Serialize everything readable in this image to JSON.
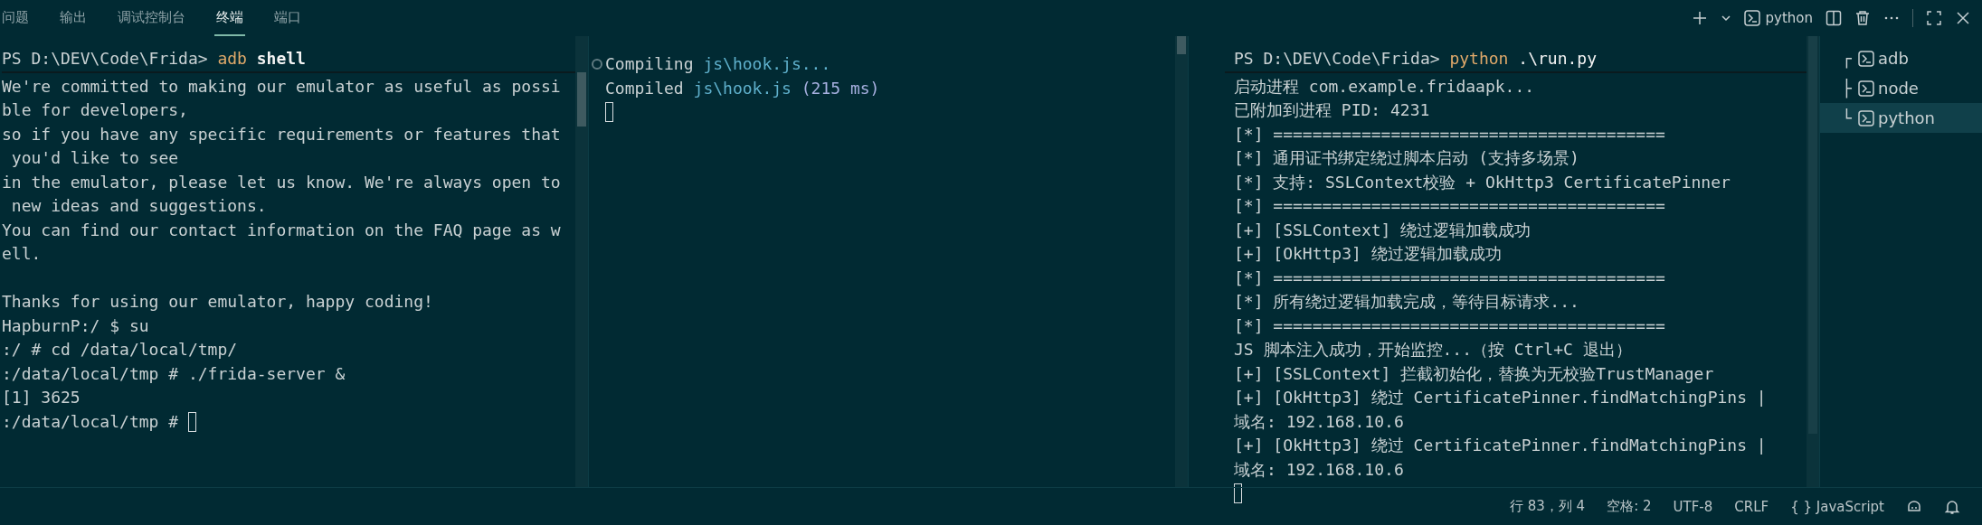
{
  "panel_tabs": [
    {
      "label": "问题",
      "selected": false
    },
    {
      "label": "输出",
      "selected": false
    },
    {
      "label": "调试控制台",
      "selected": false
    },
    {
      "label": "终端",
      "selected": true
    },
    {
      "label": "端口",
      "selected": false
    }
  ],
  "toolbar": {
    "terminal_name": "python"
  },
  "terminals": [
    {
      "lines": [
        {
          "kind": "prompt",
          "segments": [
            {
              "kind": "text",
              "text": "PS D:\\DEV\\Code\\Frida> "
            },
            {
              "kind": "command",
              "text": "adb"
            },
            {
              "kind": "argument",
              "text": " shell"
            }
          ]
        },
        {
          "kind": "output",
          "text": "We're committed to making our emulator as useful as possi"
        },
        {
          "kind": "output",
          "text": "ble for developers,"
        },
        {
          "kind": "output",
          "text": "so if you have any specific requirements or features that"
        },
        {
          "kind": "output",
          "text": " you'd like to see"
        },
        {
          "kind": "output",
          "text": "in the emulator, please let us know. We're always open to"
        },
        {
          "kind": "output",
          "text": " new ideas and suggestions."
        },
        {
          "kind": "output",
          "text": "You can find our contact information on the FAQ page as w"
        },
        {
          "kind": "output",
          "text": "ell."
        },
        {
          "kind": "blank"
        },
        {
          "kind": "output",
          "text": "Thanks for using our emulator, happy coding!"
        },
        {
          "kind": "output",
          "text": "HapburnP:/ $ su"
        },
        {
          "kind": "output",
          "text": ":/ # cd /data/local/tmp/"
        },
        {
          "kind": "output",
          "text": ":/data/local/tmp # ./frida-server &"
        },
        {
          "kind": "output",
          "text": "[1] 3625"
        },
        {
          "kind": "output",
          "text": ":/data/local/tmp # ",
          "cursor": true
        }
      ]
    },
    {
      "lines": [
        {
          "kind": "compile",
          "segments": [
            {
              "kind": "text",
              "text": "Compiling "
            },
            {
              "kind": "path",
              "text": "js\\hook.js..."
            }
          ]
        },
        {
          "kind": "output",
          "segments": [
            {
              "kind": "text",
              "text": "Compiled "
            },
            {
              "kind": "path",
              "text": "js\\hook.js"
            },
            {
              "kind": "number",
              "text": " (215 ms)"
            }
          ]
        },
        {
          "kind": "blank",
          "cursor": true
        }
      ]
    },
    {
      "lines": [
        {
          "kind": "prompt",
          "segments": [
            {
              "kind": "text",
              "text": "PS D:\\DEV\\Code\\Frida> "
            },
            {
              "kind": "command",
              "text": "python"
            },
            {
              "kind": "argument",
              "text": " .\\run.py"
            }
          ]
        },
        {
          "kind": "output",
          "text": "启动进程 com.example.fridaapk..."
        },
        {
          "kind": "output",
          "text": "已附加到进程 PID: 4231"
        },
        {
          "kind": "output",
          "text": "[*] ========================================"
        },
        {
          "kind": "output",
          "text": "[*] 通用证书绑定绕过脚本启动 (支持多场景)"
        },
        {
          "kind": "output",
          "text": "[*] 支持: SSLContext校验 + OkHttp3 CertificatePinner"
        },
        {
          "kind": "output",
          "text": "[*] ========================================"
        },
        {
          "kind": "output",
          "text": "[+] [SSLContext] 绕过逻辑加载成功"
        },
        {
          "kind": "output",
          "text": "[+] [OkHttp3] 绕过逻辑加载成功"
        },
        {
          "kind": "output",
          "text": "[*] ========================================"
        },
        {
          "kind": "output",
          "text": "[*] 所有绕过逻辑加载完成，等待目标请求..."
        },
        {
          "kind": "output",
          "text": "[*] ========================================"
        },
        {
          "kind": "output",
          "text": "JS 脚本注入成功，开始监控...（按 Ctrl+C 退出）"
        },
        {
          "kind": "output",
          "text": "[+] [SSLContext] 拦截初始化，替换为无校验TrustManager"
        },
        {
          "kind": "output",
          "text": "[+] [OkHttp3] 绕过 CertificatePinner.findMatchingPins |"
        },
        {
          "kind": "output",
          "text": "域名: 192.168.10.6"
        },
        {
          "kind": "output",
          "text": "[+] [OkHttp3] 绕过 CertificatePinner.findMatchingPins |"
        },
        {
          "kind": "output",
          "text": "域名: 192.168.10.6"
        },
        {
          "kind": "blank",
          "cursor": true
        }
      ]
    }
  ],
  "terminal_list": [
    {
      "tree": "┌",
      "name": "adb",
      "selected": false
    },
    {
      "tree": "├",
      "name": "node",
      "selected": false
    },
    {
      "tree": "└",
      "name": "python",
      "selected": true
    }
  ],
  "status_bar": [
    "行 83，列 4",
    "空格: 2",
    "UTF-8",
    "CRLF",
    "{ } JavaScript"
  ]
}
